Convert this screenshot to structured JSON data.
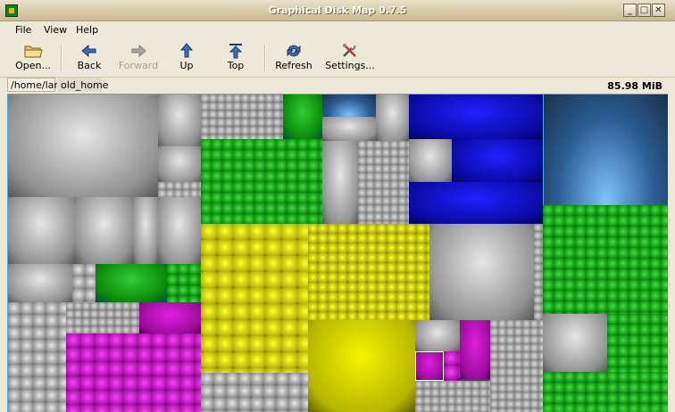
{
  "window": {
    "title": "Graphical Disk Map 0.7.5",
    "controls": {
      "minimize": "_",
      "maximize": "□",
      "close": "✕"
    }
  },
  "menu": {
    "file": "File",
    "view": "View",
    "help": "Help"
  },
  "toolbar": {
    "open": "Open...",
    "back": "Back",
    "forward": "Forward",
    "up": "Up",
    "top": "Top",
    "refresh": "Refresh",
    "settings": "Settings..."
  },
  "path": {
    "segments": [
      "/home/lam",
      "old_home"
    ]
  },
  "total_size": "85.98 MiB",
  "colors": {
    "gray": "#9a9a9a",
    "green": "#0a9a0a",
    "yellow": "#d8d800",
    "purple": "#b010b0",
    "blue": "#1010c8",
    "light_blue": "#5aa0e8",
    "selection": "#ffffff"
  }
}
